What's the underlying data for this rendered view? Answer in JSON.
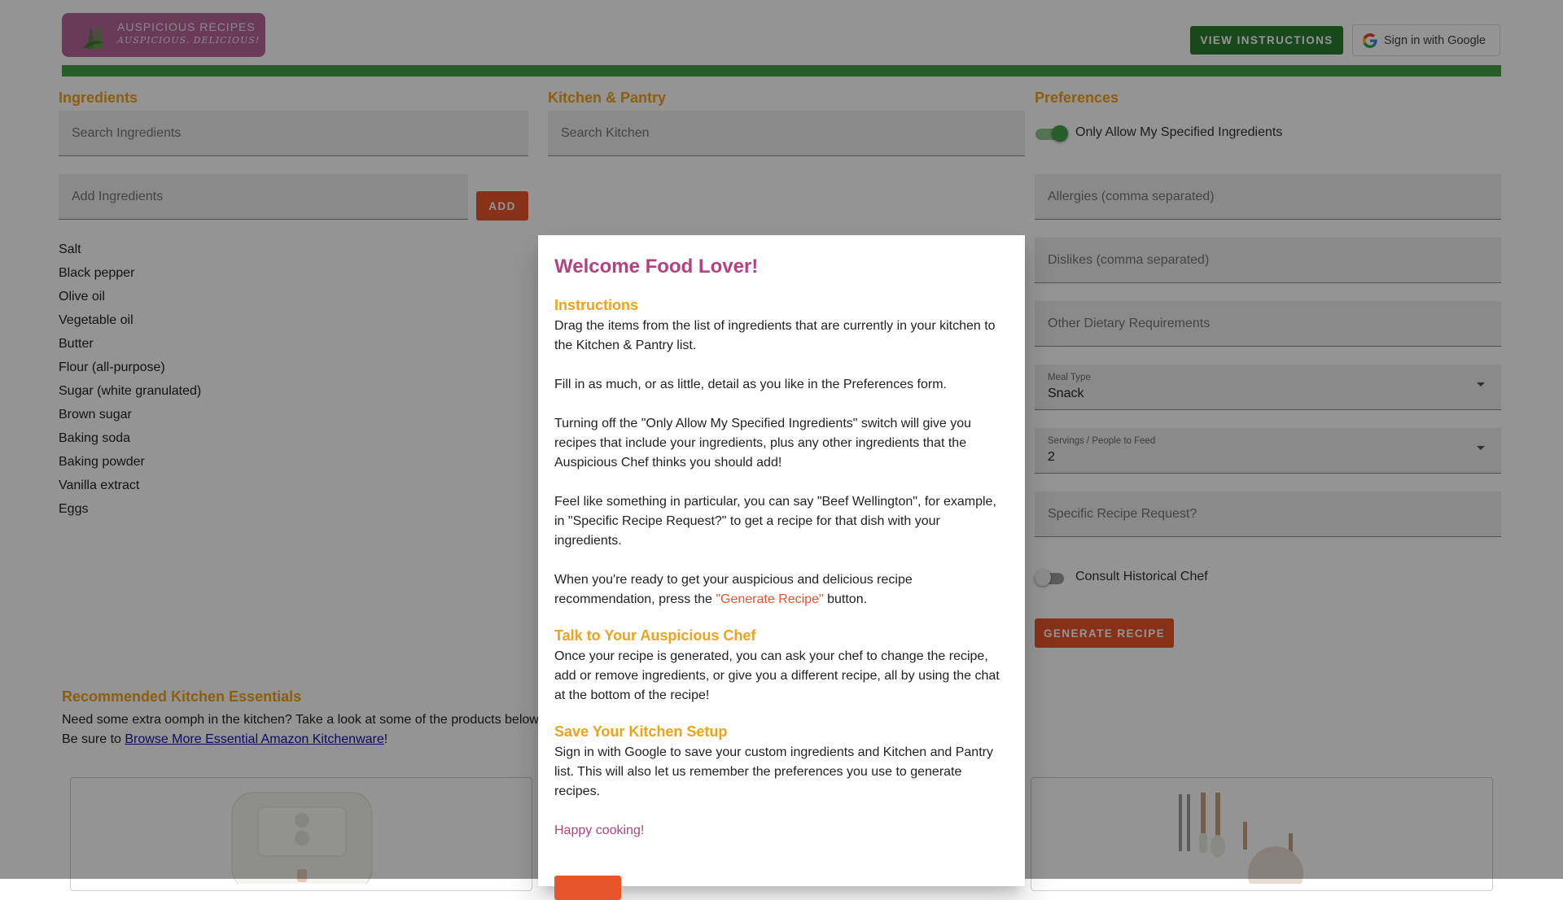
{
  "header": {
    "logo_title": "AUSPICIOUS RECIPES",
    "logo_tagline": "AUSPICIOUS. DELICIOUS!",
    "instructions_button": "VIEW INSTRUCTIONS",
    "google_signin": "Sign in with Google"
  },
  "colors": {
    "accent_green": "#43a047",
    "accent_orange": "#e8552b",
    "heading_gold": "#f2a219",
    "brand_pink": "#b3437f"
  },
  "ingredients": {
    "title": "Ingredients",
    "search_placeholder": "Search Ingredients",
    "add_placeholder": "Add Ingredients",
    "add_button": "ADD",
    "items": [
      "Salt",
      "Black pepper",
      "Olive oil",
      "Vegetable oil",
      "Butter",
      "Flour (all-purpose)",
      "Sugar (white granulated)",
      "Brown sugar",
      "Baking soda",
      "Baking powder",
      "Vanilla extract",
      "Eggs"
    ]
  },
  "kitchen": {
    "title": "Kitchen & Pantry",
    "search_placeholder": "Search Kitchen"
  },
  "preferences": {
    "title": "Preferences",
    "only_allow_label": "Only Allow My Specified Ingredients",
    "only_allow_on": true,
    "allergies_placeholder": "Allergies (comma separated)",
    "dislikes_placeholder": "Dislikes (comma separated)",
    "dietary_placeholder": "Other Dietary Requirements",
    "meal_type_label": "Meal Type",
    "meal_type_value": "Snack",
    "servings_label": "Servings / People to Feed",
    "servings_value": "2",
    "specific_request_placeholder": "Specific Recipe Request?",
    "historical_chef_label": "Consult Historical Chef",
    "historical_chef_on": false,
    "generate_button": "GENERATE RECIPE"
  },
  "recommended": {
    "title": "Recommended Kitchen Essentials",
    "line1": "Need some extra oomph in the kitchen? Take a look at some of the products below",
    "line2_prefix": "Be sure to ",
    "link_text": "Browse More Essential Amazon Kitchenware",
    "line2_suffix": "!"
  },
  "modal": {
    "title": "Welcome Food Lover!",
    "instructions_heading": "Instructions",
    "p1": "Drag the items from the list of ingredients that are currently in your kitchen to the Kitchen & Pantry list.",
    "p2": "Fill in as much, or as little, detail as you like in the Preferences form.",
    "p3": "Turning off the \"Only Allow My Specified Ingredients\" switch will give you recipes that include your ingredients, plus any other ingredients that the Auspicious Chef thinks you should add!",
    "p4": "Feel like something in particular, you can say \"Beef Wellington\", for example, in \"Specific Recipe Request?\" to get a recipe for that dish with your ingredients.",
    "p5_prefix": "When you're ready to get your auspicious and delicious recipe recommendation, press the ",
    "p5_highlight": "\"Generate Recipe\"",
    "p5_suffix": " button.",
    "chef_heading": "Talk to Your Auspicious Chef",
    "p6": "Once your recipe is generated, you can ask your chef to change the recipe, add or remove ingredients, or give you a different recipe, all by using the chat at the bottom of the recipe!",
    "save_heading": "Save Your Kitchen Setup",
    "p7": "Sign in with Google to save your custom ingredients and Kitchen and Pantry list. This will also let us remember the preferences you use to generate recipes.",
    "closing": "Happy cooking!"
  }
}
